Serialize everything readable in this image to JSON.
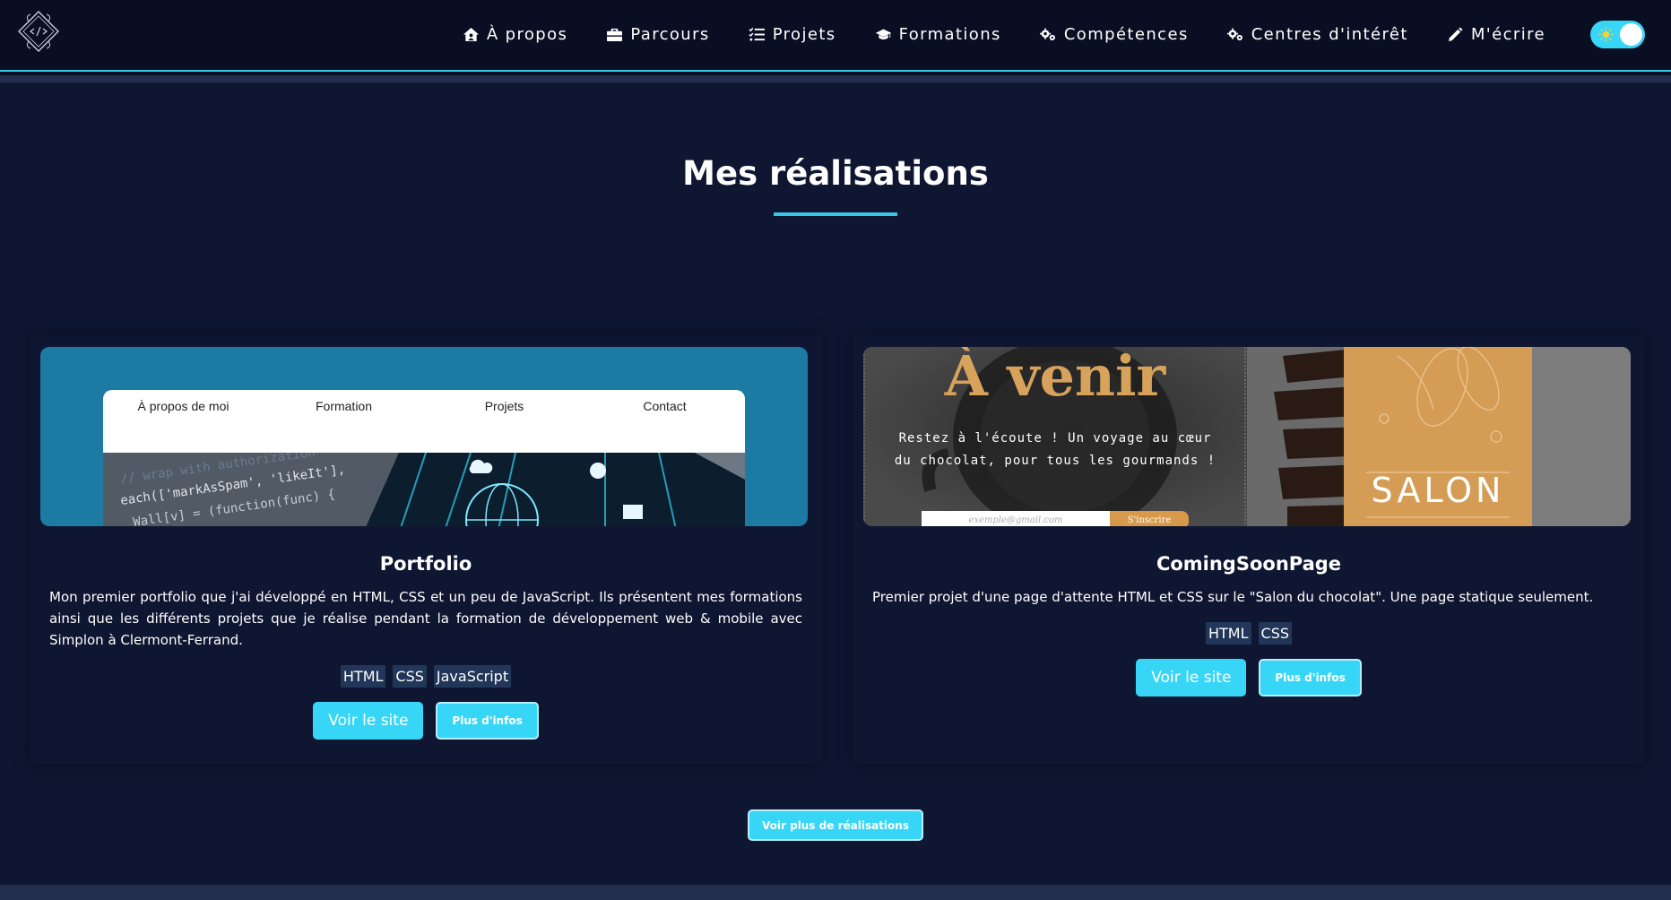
{
  "nav": {
    "items": [
      {
        "label": "À propos",
        "icon": "house-user-icon"
      },
      {
        "label": "Parcours",
        "icon": "briefcase-icon"
      },
      {
        "label": "Projets",
        "icon": "list-check-icon"
      },
      {
        "label": "Formations",
        "icon": "graduation-cap-icon"
      },
      {
        "label": "Compétences",
        "icon": "gears-icon"
      },
      {
        "label": "Centres d'intérêt",
        "icon": "gears-icon"
      },
      {
        "label": "M'écrire",
        "icon": "pencil-icon"
      }
    ],
    "theme_toggle": {
      "state": "on",
      "icon": "sun-icon"
    }
  },
  "section": {
    "title": "Mes réalisations",
    "more_button": "Voir plus de réalisations"
  },
  "projects": [
    {
      "title": "Portfolio",
      "description": "Mon premier portfolio que j'ai développé en HTML, CSS et un peu de JavaScript. Ils présentent mes formations ainsi que les différents projets que je réalise pendant la formation de développement web & mobile avec Simplon à Clermont-Ferrand.",
      "tags": [
        "HTML",
        "CSS",
        "JavaScript"
      ],
      "visit_label": "Voir le site",
      "info_label": "Plus d'infos",
      "preview": {
        "nav": [
          "À propos de moi",
          "Formation",
          "Projets",
          "Contact"
        ]
      }
    },
    {
      "title": "ComingSoonPage",
      "description": "Premier projet d'une page d'attente HTML et CSS sur le \"Salon du chocolat\". Une page statique seulement.",
      "tags": [
        "HTML",
        "CSS"
      ],
      "visit_label": "Voir le site",
      "info_label": "Plus d'infos",
      "preview": {
        "heading": "À venir",
        "text": "Restez à l'écoute ! Un voyage au cœur du chocolat, pour tous les gourmands !",
        "input_placeholder": "exemple@gmail.com",
        "submit": "S'inscrire",
        "brand": "SALON"
      }
    }
  ],
  "colors": {
    "background": "#0f1631",
    "navbar": "#090e22",
    "accent": "#38d6f6",
    "tag_bg": "#213658"
  }
}
